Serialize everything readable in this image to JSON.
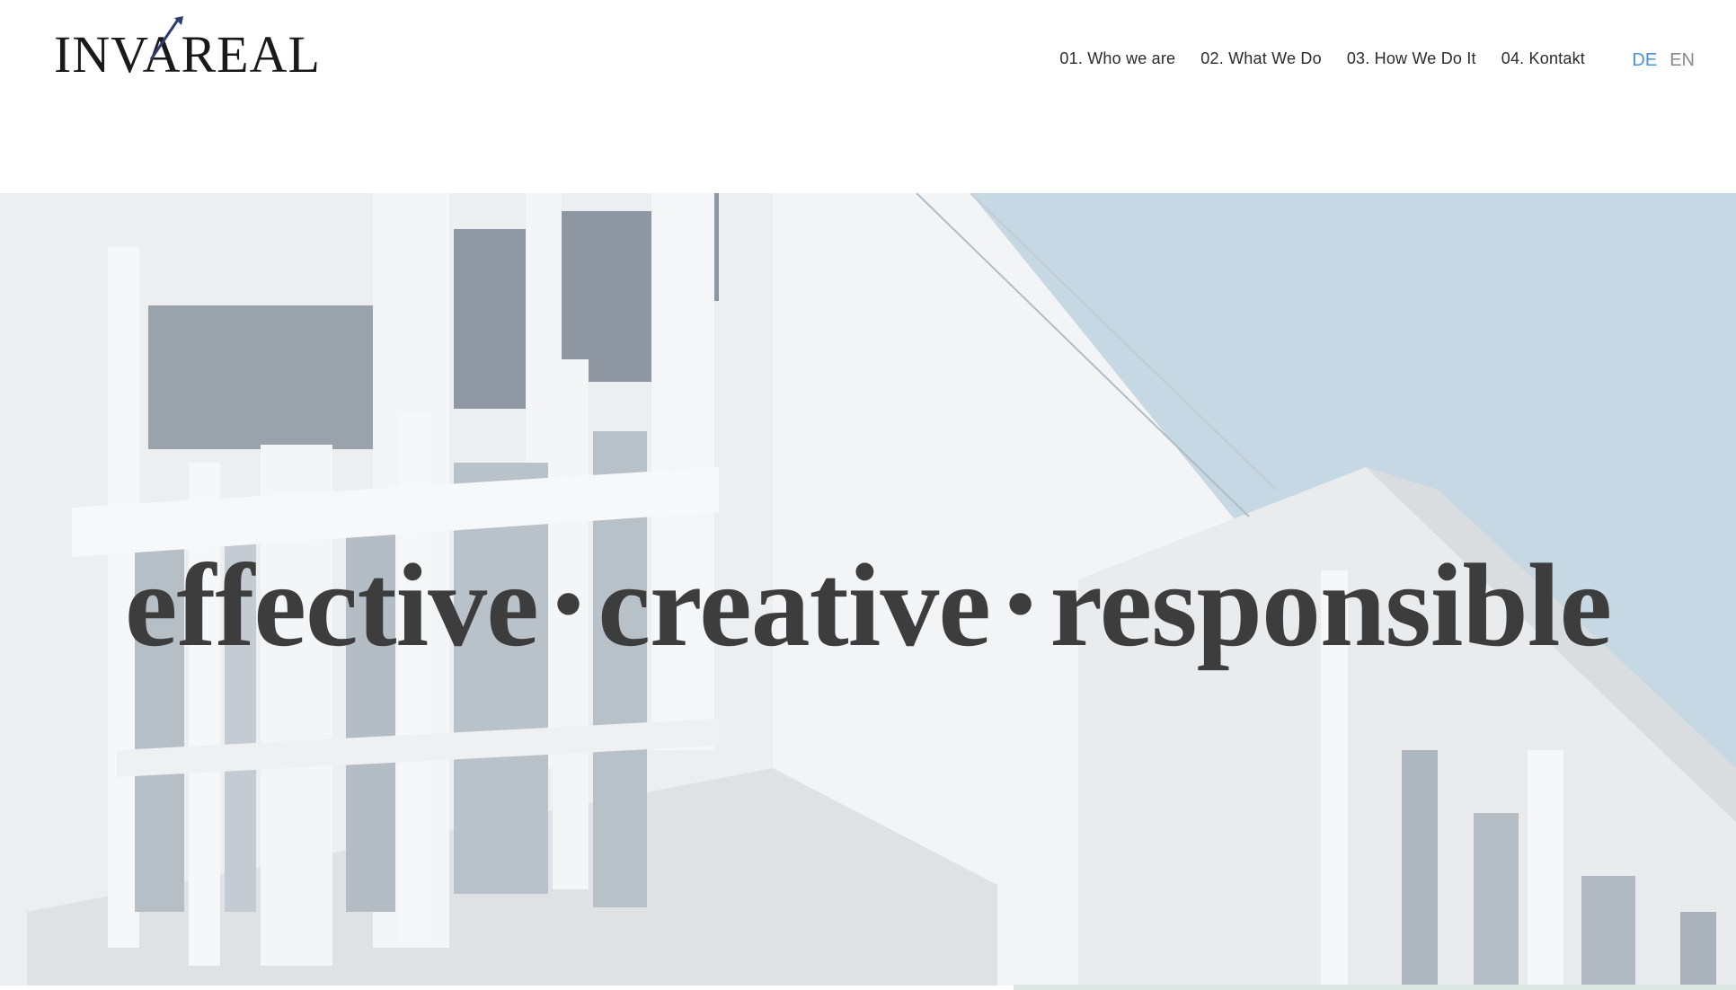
{
  "brand": {
    "name": "INVAREAL"
  },
  "nav": {
    "items": [
      {
        "label": "01. Who we are"
      },
      {
        "label": "02. What We Do"
      },
      {
        "label": "03. How We Do It"
      },
      {
        "label": "04. Kontakt"
      }
    ]
  },
  "lang": {
    "de": "DE",
    "en": "EN",
    "active": "DE"
  },
  "hero": {
    "words": [
      "effective",
      "creative",
      "responsible"
    ],
    "separator": "•"
  },
  "colors": {
    "accent_blue": "#4a90e2",
    "logo_arrow": "#2c3e70",
    "sky": "#c6d8e4",
    "text_dark": "#3d3d3d"
  }
}
